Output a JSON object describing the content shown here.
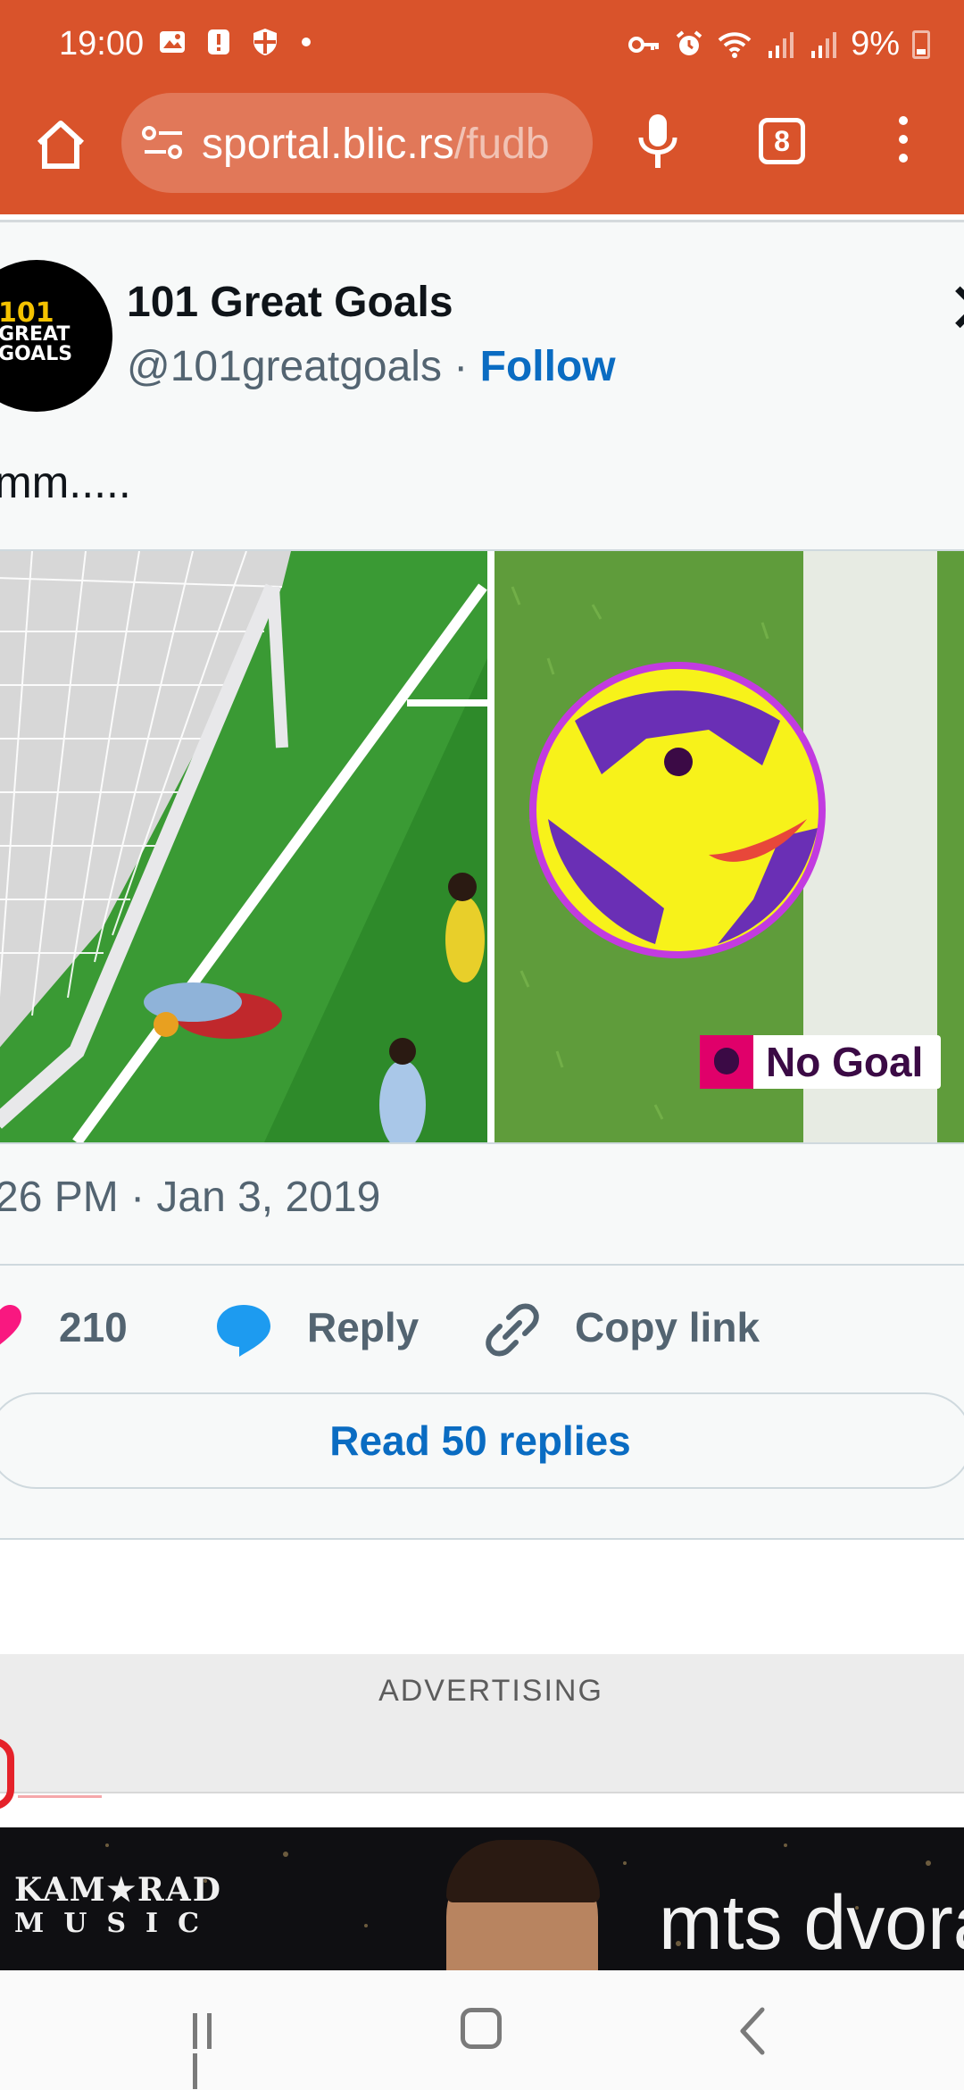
{
  "status_bar": {
    "time": "19:00",
    "battery": "9%",
    "icons": [
      "image-icon",
      "alert-icon",
      "shield-icon",
      "dot-icon",
      "vpn-key-icon",
      "alarm-icon",
      "wifi-icon",
      "signal-icon",
      "signal-icon",
      "battery-icon"
    ]
  },
  "browser": {
    "url_host": "sportal.blic.rs",
    "url_path": "/fudb",
    "tab_count": "8",
    "toolbar_color": "#d9532b"
  },
  "tweet": {
    "author_name": "101 Great Goals",
    "handle": "@101greatgoals",
    "separator": " · ",
    "follow_label": "Follow",
    "avatar_text_top": "101",
    "avatar_text_bottom1": "GREAT",
    "avatar_text_bottom2": "GOALS",
    "text": "mm.....",
    "media_overlay": "No Goal",
    "timestamp": "26 PM · Jan 3, 2019",
    "likes": "210",
    "reply_label": "Reply",
    "copy_link_label": "Copy link",
    "read_replies_label": "Read 50 replies"
  },
  "ad": {
    "label": "ADVERTISING",
    "brand_line1": "KAM★RAD",
    "brand_line2": "MUSIC",
    "title": "mts dvorano"
  },
  "colors": {
    "link_blue": "#0a6cc2",
    "like_pink": "#f91880",
    "reply_blue": "#1d9bf0"
  }
}
